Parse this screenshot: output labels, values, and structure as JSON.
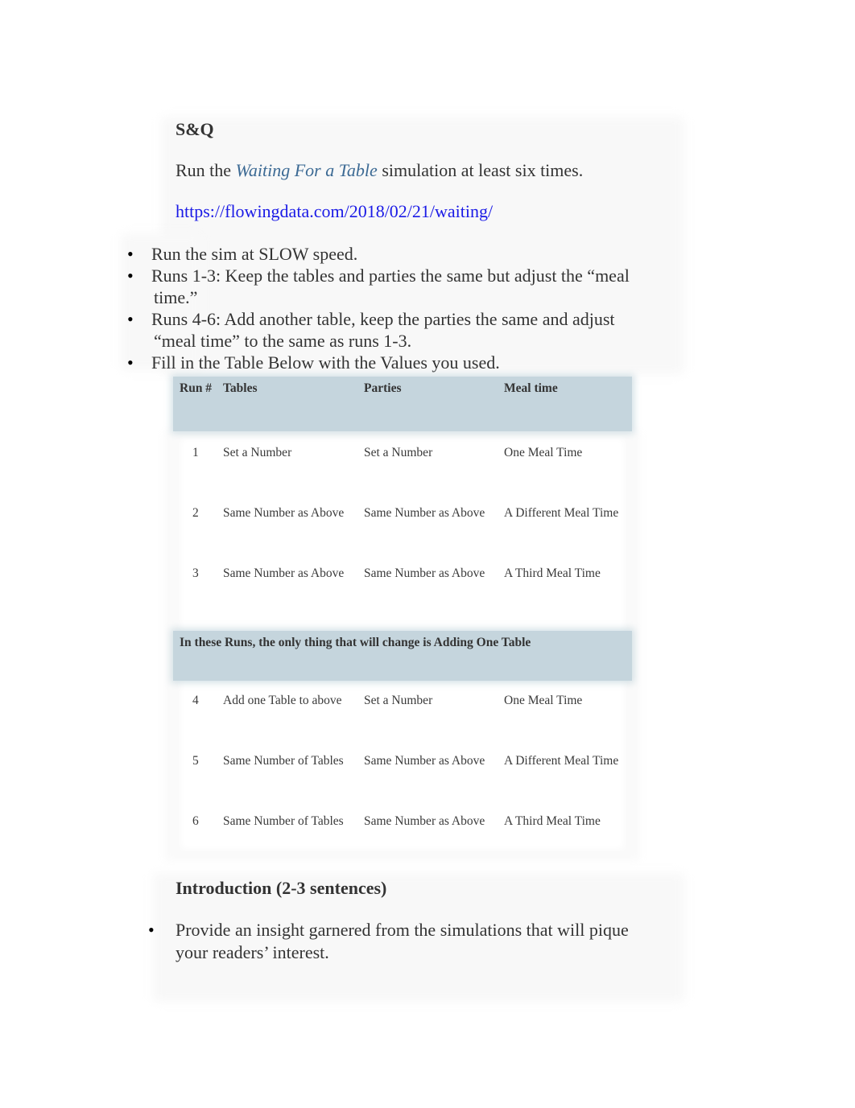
{
  "document": {
    "heading": "S&Q",
    "intro_prefix": "Run the ",
    "intro_link": "Waiting For a Table",
    "intro_suffix": " simulation at least six times.",
    "url": "https://flowingdata.com/2018/02/21/waiting/",
    "bullets": [
      {
        "line1": "Run the sim at SLOW speed.",
        "line2": ""
      },
      {
        "line1": "Runs 1-3: Keep the tables and parties the same but adjust the “meal",
        "line2": "time.”"
      },
      {
        "line1": "Runs 4-6: Add another table, keep the parties the same and adjust",
        "line2": "“meal time” to the same as runs 1-3."
      },
      {
        "line1": "Fill in the Table Below with the Values you used.",
        "line2": ""
      }
    ],
    "table": {
      "headers": [
        "Run #",
        "Tables",
        "Parties",
        "Meal time"
      ],
      "rows_a": [
        [
          "1",
          "Set a Number",
          "Set a Number",
          "One Meal Time"
        ],
        [
          "2",
          "Same Number as Above",
          "Same Number as Above",
          "A Different Meal Time"
        ],
        [
          "3",
          "Same Number as Above",
          "Same Number as Above",
          "A Third Meal Time"
        ]
      ],
      "section_label": "In these Runs, the only thing that will change is Adding One Table",
      "rows_b": [
        [
          "4",
          "Add one Table to above",
          "Set a Number",
          "One Meal Time"
        ],
        [
          "5",
          "Same Number of Tables",
          "Same Number as Above",
          "A Different Meal Time"
        ],
        [
          "6",
          "Same Number of Tables",
          "Same Number as Above",
          "A Third Meal Time"
        ]
      ]
    },
    "intro_heading": "Introduction (2-3 sentences)",
    "intro_bullet_line1": "Provide an insight garnered from the simulations that will pique",
    "intro_bullet_line2": "your readers’ interest."
  },
  "colors": {
    "header_fill": "#c5d5dd",
    "link_blue": "#1a1ae6",
    "italic_link": "#3c6a94",
    "text": "#333333"
  }
}
